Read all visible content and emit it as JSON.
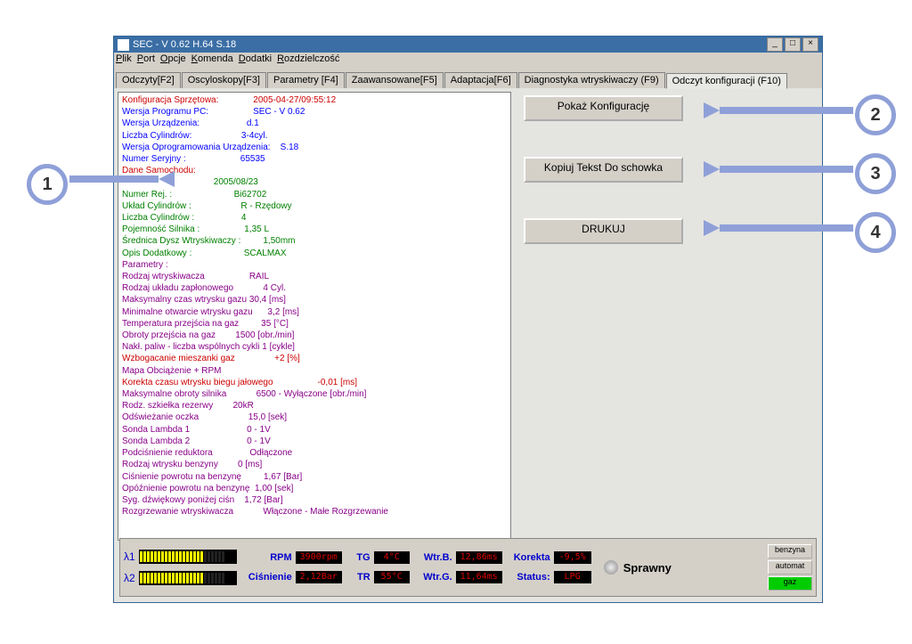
{
  "window": {
    "title": "SEC - V 0.62 H.64 S.18"
  },
  "menu": [
    "Plik",
    "Port",
    "Opcje",
    "Komenda",
    "Dodatki",
    "Rozdzielczość"
  ],
  "menu_u": [
    "P",
    "P",
    "O",
    "K",
    "D",
    "R"
  ],
  "tabs": [
    "Odczyty[F2]",
    "Oscyloskopy[F3]",
    "Parametry [F4]",
    "Zaawansowane[F5]",
    "Adaptacja[F6]",
    "Diagnostyka wtryskiwaczy (F9)",
    "Odczyt konfiguracji (F10)"
  ],
  "active_tab": 6,
  "buttons": {
    "show": "Pokaż Konfigurację",
    "copy": "Kopiuj Tekst Do schowka",
    "print": "DRUKUJ"
  },
  "config_lines": [
    {
      "c": "r",
      "t": "Konfiguracja Sprzętowa:              2005-04-27/09:55:12"
    },
    {
      "c": "b",
      "t": "Wersja Programu PC:                  SEC - V 0.62"
    },
    {
      "c": "b",
      "t": "Wersja Urządzenia:                   d.1"
    },
    {
      "c": "b",
      "t": "Liczba Cylindrów:                    3-4cyl."
    },
    {
      "c": "b",
      "t": "Wersja Oprogramowania Urządzenia:    S.18"
    },
    {
      "c": "b",
      "t": "Numer Seryjny :                      65535"
    },
    {
      "c": "r",
      "t": "Dane Samochodu:"
    },
    {
      "c": "g",
      "t": "                                     2005/08/23"
    },
    {
      "c": "g",
      "t": "Numer Rej. :                         Bi62702"
    },
    {
      "c": "g",
      "t": "Układ Cylindrów :                    R - Rzędowy"
    },
    {
      "c": "g",
      "t": "Liczba Cylindrów :                   4"
    },
    {
      "c": "g",
      "t": "Pojemność Silnika :                  1,35 L"
    },
    {
      "c": "g",
      "t": "Średnica Dysz Wtryskiwaczy :         1,50mm"
    },
    {
      "c": "g",
      "t": "Opis Dodatkowy :                     SCALMAX"
    },
    {
      "c": "p",
      "t": "Parametry :"
    },
    {
      "c": "p",
      "t": "Rodzaj wtryskiwacza                  RAIL"
    },
    {
      "c": "p",
      "t": "Rodzaj układu zapłonowego            4 Cyl."
    },
    {
      "c": "p",
      "t": "Maksymalny czas wtrysku gazu 30,4 [ms]"
    },
    {
      "c": "p",
      "t": "Minimalne otwarcie wtrysku gazu      3,2 [ms]"
    },
    {
      "c": "p",
      "t": "Temperatura przejścia na gaz         35 [°C]"
    },
    {
      "c": "p",
      "t": "Obroty przejścia na gaz        1500 [obr./min]"
    },
    {
      "c": "p",
      "t": "Nakł. paliw - liczba wspólnych cykli 1 [cykle]"
    },
    {
      "c": "r",
      "t": "Wzbogacanie mieszanki gaz                +2 [%]"
    },
    {
      "c": "p",
      "t": "Mapa Obciążenie + RPM"
    },
    {
      "c": "r",
      "t": "Korekta czasu wtrysku biegu jałowego                  -0,01 [ms]"
    },
    {
      "c": "p",
      "t": "Maksymalne obroty silnika            6500 - Wyłączone [obr./min]"
    },
    {
      "c": "p",
      "t": "Rodz. szkiełka rezerwy        20kR"
    },
    {
      "c": "p",
      "t": "Odświeżanie oczka                    15,0 [sek]"
    },
    {
      "c": "p",
      "t": "Sonda Lambda 1                       0 - 1V"
    },
    {
      "c": "p",
      "t": "Sonda Lambda 2                       0 - 1V"
    },
    {
      "c": "p",
      "t": "Podciśnienie reduktora               Odłączone"
    },
    {
      "c": "p",
      "t": "Rodzaj wtrysku benzyny        0 [ms]"
    },
    {
      "c": "p",
      "t": "Ciśnienie powrotu na benzynę         1,67 [Bar]"
    },
    {
      "c": "p",
      "t": "Opóźnienie powrotu na benzynę  1,00 [sek]"
    },
    {
      "c": "p",
      "t": "Syg. dźwiękowy poniżej ciśn    1,72 [Bar]"
    },
    {
      "c": "p",
      "t": "Rozgrzewanie wtryskiwacza            Włączone - Małe Rozgrzewanie"
    }
  ],
  "status": {
    "l1": "λ1",
    "l2": "λ2",
    "rpm_lab": "RPM",
    "rpm_val": "3900rpm",
    "cis_lab": "Ciśnienie",
    "cis_val": "2,12Bar",
    "tg_lab": "TG",
    "tg_val": "4°C",
    "tr_lab": "TR",
    "tr_val": "55°C",
    "wtrb_lab": "Wtr.B.",
    "wtrb_val": "12,86ms",
    "wtrg_lab": "Wtr.G.",
    "wtrg_val": "11,64ms",
    "kor_lab": "Korekta",
    "kor_val": "-9,5%",
    "stat_lab": "Status:",
    "stat_val": "LPG",
    "sprawny": "Sprawny",
    "benzyna": "benzyna",
    "automat": "automat",
    "gaz": "gaz"
  },
  "callouts": {
    "c1": "1",
    "c2": "2",
    "c3": "3",
    "c4": "4"
  }
}
